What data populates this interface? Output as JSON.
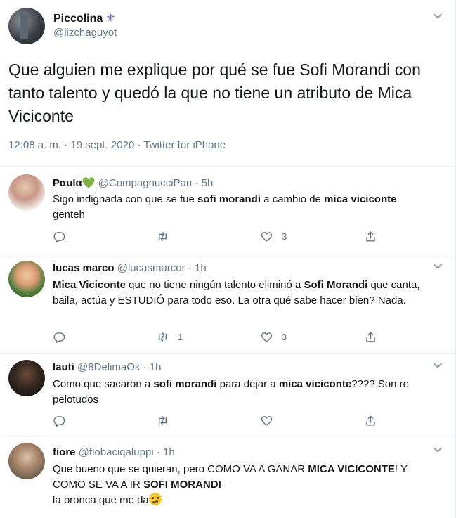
{
  "main_tweet": {
    "display_name": "Piccolina",
    "name_emoji": "⚜",
    "handle": "@lizchaguyot",
    "text": "Que alguien me explique por qué se fue Sofi Morandi con tanto talento y quedó la que no tiene un atributo de Mica Viciconte",
    "meta": "12:08 a. m. · 19 sept. 2020 · Twitter for iPhone"
  },
  "replies": [
    {
      "display_name": "Pαulα",
      "name_emoji": "💚",
      "handle": "@CompagnucciPau",
      "dot": "·",
      "time": "5h",
      "text_parts": [
        "Sigo indignada con que se fue ",
        "sofi morandi",
        " a cambio de ",
        "mica viciconte",
        " genteh"
      ],
      "reply_count": "",
      "retweet_count": "",
      "like_count": "3"
    },
    {
      "display_name": "lucas marco",
      "handle": "@lucasmarcor",
      "dot": "·",
      "time": "1h",
      "text_parts": [
        "Mica Viciconte",
        " que no tiene ningún talento eliminó a ",
        "Sofi Morandi",
        " que canta, baila, actúa y ESTUDIÓ para todo eso. La otra qué sabe hacer bien? Nada."
      ],
      "reply_count": "",
      "retweet_count": "1",
      "like_count": "3"
    },
    {
      "display_name": "lauti",
      "handle": "@8DelimaOk",
      "dot": "·",
      "time": "1h",
      "text_parts": [
        "Como que sacaron a ",
        "sofi morandi",
        " para dejar a ",
        "mica viciconte",
        "???? Son re pelotudos"
      ],
      "reply_count": "",
      "retweet_count": "",
      "like_count": ""
    },
    {
      "display_name": "fiore",
      "handle": "@fiobaciqaluppi",
      "dot": "·",
      "time": "1h",
      "text_parts": [
        "Que bueno que se quieran, pero COMO VA A GANAR ",
        "MICA VICICONTE",
        "! Y COMO SE VA A IR ",
        "SOFI MORANDI",
        "la bronca que me da"
      ]
    }
  ],
  "icons": {
    "reply": "reply-icon",
    "retweet": "retweet-icon",
    "like": "heart-icon",
    "share": "share-icon",
    "more": "chevron-down-icon"
  },
  "colors": {
    "text": "#14171a",
    "secondary": "#657786",
    "border": "#e6ecf0",
    "fleur": "#7a5cc5",
    "green_heart": "#6cc24a"
  }
}
